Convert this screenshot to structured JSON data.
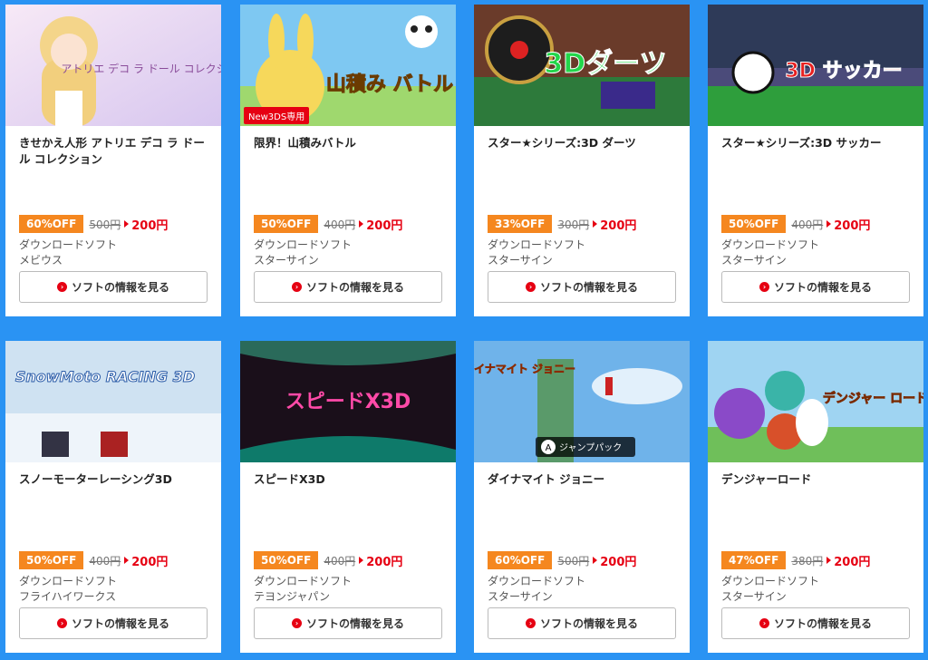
{
  "cards": [
    {
      "title": "きせかえ人形 アトリエ デコ ラ ドール コレクション",
      "badge": "",
      "off": "60%OFF",
      "old_price": "500円",
      "new_price": "200円",
      "category": "ダウンロードソフト",
      "publisher": "メビウス",
      "button": "ソフトの情報を見る",
      "thumb_logo": "アトリエ デコ ラ ドール コレクション"
    },
    {
      "title": "限界！山積みバトル",
      "badge": "New3DS専用",
      "off": "50%OFF",
      "old_price": "400円",
      "new_price": "200円",
      "category": "ダウンロードソフト",
      "publisher": "スターサイン",
      "button": "ソフトの情報を見る",
      "thumb_logo": "山積み バトル"
    },
    {
      "title": "スター★シリーズ:3D ダーツ",
      "badge": "",
      "off": "33%OFF",
      "old_price": "300円",
      "new_price": "200円",
      "category": "ダウンロードソフト",
      "publisher": "スターサイン",
      "button": "ソフトの情報を見る",
      "thumb_logo": "3Dダーツ"
    },
    {
      "title": "スター★シリーズ:3D サッカー",
      "badge": "",
      "off": "50%OFF",
      "old_price": "400円",
      "new_price": "200円",
      "category": "ダウンロードソフト",
      "publisher": "スターサイン",
      "button": "ソフトの情報を見る",
      "thumb_logo": "3D サッカー"
    },
    {
      "title": "スノーモーターレーシング3D",
      "badge": "",
      "off": "50%OFF",
      "old_price": "400円",
      "new_price": "200円",
      "category": "ダウンロードソフト",
      "publisher": "フライハイワークス",
      "button": "ソフトの情報を見る",
      "thumb_logo": "SnowMoto RACING 3D"
    },
    {
      "title": "スピードX3D",
      "badge": "",
      "off": "50%OFF",
      "old_price": "400円",
      "new_price": "200円",
      "category": "ダウンロードソフト",
      "publisher": "テヨンジャパン",
      "button": "ソフトの情報を見る",
      "thumb_logo": "スピードX3D"
    },
    {
      "title": "ダイナマイト ジョニー",
      "badge": "",
      "off": "60%OFF",
      "old_price": "500円",
      "new_price": "200円",
      "category": "ダウンロードソフト",
      "publisher": "スターサイン",
      "button": "ソフトの情報を見る",
      "thumb_logo": "ダイナマイト ジョニー",
      "thumb_hint": "ジャンプパック"
    },
    {
      "title": "デンジャーロード",
      "badge": "",
      "off": "47%OFF",
      "old_price": "380円",
      "new_price": "200円",
      "category": "ダウンロードソフト",
      "publisher": "スターサイン",
      "button": "ソフトの情報を見る",
      "thumb_logo": "デンジャー ロード"
    }
  ],
  "colors": {
    "background": "#2a93f3",
    "off_badge": "#f5871f",
    "sale_price": "#e60012"
  }
}
